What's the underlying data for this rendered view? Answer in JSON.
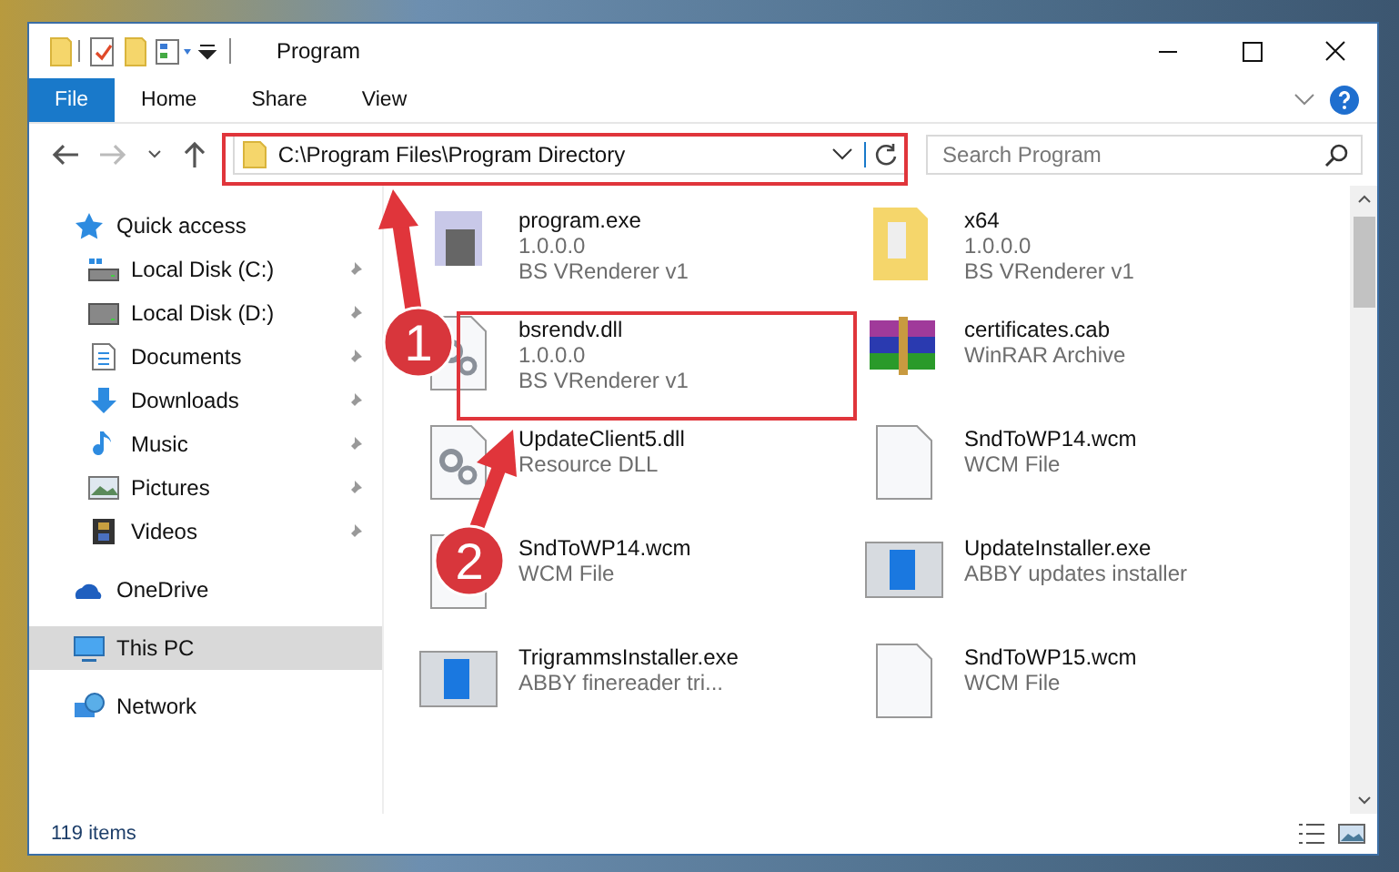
{
  "window": {
    "title": "Program"
  },
  "ribbon_tabs": [
    {
      "label": "File",
      "selected": true
    },
    {
      "label": "Home",
      "selected": false
    },
    {
      "label": "Share",
      "selected": false
    },
    {
      "label": "View",
      "selected": false
    }
  ],
  "address": {
    "path": "C:\\Program Files\\Program Directory"
  },
  "search": {
    "placeholder": "Search Program"
  },
  "sidebar": {
    "items": [
      {
        "label": "Quick access",
        "kind": "star",
        "selected": false,
        "children": [
          {
            "label": "Local Disk (C:)",
            "kind": "disk-c",
            "pinned": true
          },
          {
            "label": "Local Disk (D:)",
            "kind": "disk",
            "pinned": true
          },
          {
            "label": "Documents",
            "kind": "documents",
            "pinned": true
          },
          {
            "label": "Downloads",
            "kind": "downloads",
            "pinned": true
          },
          {
            "label": "Music",
            "kind": "music",
            "pinned": true
          },
          {
            "label": "Pictures",
            "kind": "pictures",
            "pinned": true
          },
          {
            "label": "Videos",
            "kind": "videos",
            "pinned": true
          }
        ]
      },
      {
        "label": "OneDrive",
        "kind": "cloud",
        "selected": false
      },
      {
        "label": "This PC",
        "kind": "pc",
        "selected": true
      },
      {
        "label": "Network",
        "kind": "network",
        "selected": false
      }
    ]
  },
  "files": [
    {
      "name": "program.exe",
      "details": [
        "1.0.0.0",
        "BS VRenderer v1"
      ],
      "kind": "exe"
    },
    {
      "name": "x64",
      "details": [
        "1.0.0.0",
        "BS VRenderer v1"
      ],
      "kind": "folder"
    },
    {
      "name": "bsrendv.dll",
      "details": [
        "1.0.0.0",
        "BS VRenderer v1"
      ],
      "kind": "dll"
    },
    {
      "name": "certificates.cab",
      "details": [
        "WinRAR Archive"
      ],
      "kind": "archive"
    },
    {
      "name": "UpdateClient5.dll",
      "details": [
        "Resource DLL"
      ],
      "kind": "dll"
    },
    {
      "name": "SndToWP14.wcm",
      "details": [
        "WCM File"
      ],
      "kind": "blank"
    },
    {
      "name": "SndToWP14.wcm",
      "details": [
        "WCM File"
      ],
      "kind": "blank"
    },
    {
      "name": "UpdateInstaller.exe",
      "details": [
        "ABBY updates installer"
      ],
      "kind": "installer"
    },
    {
      "name": "TrigrammsInstaller.exe",
      "details": [
        "ABBY finereader tri..."
      ],
      "kind": "installer"
    },
    {
      "name": "SndToWP15.wcm",
      "details": [
        "WCM File"
      ],
      "kind": "blank"
    }
  ],
  "annotations": {
    "badges": [
      "1",
      "2"
    ]
  },
  "status_bar": {
    "count": "119 items"
  }
}
